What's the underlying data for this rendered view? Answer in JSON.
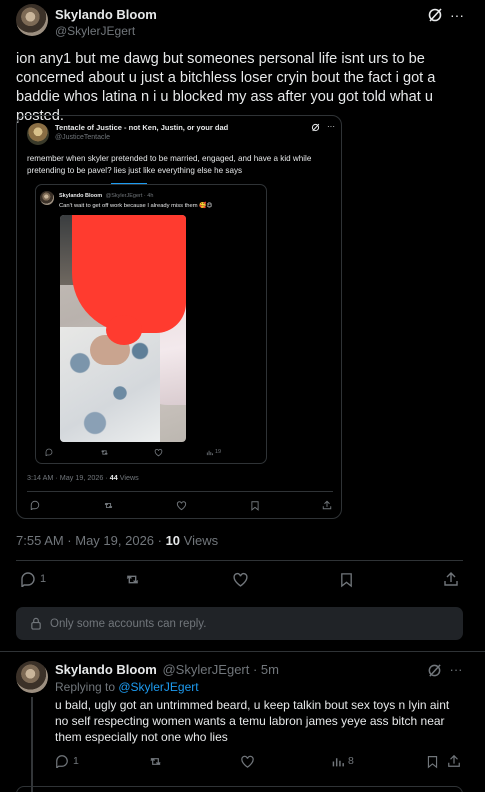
{
  "main_post": {
    "name": "Skylando Bloom",
    "handle": "@SkylerJEgert",
    "text": "ion any1 but me dawg but someones personal life isnt urs to be concerned about u just a bitchless loser cryin bout the fact i got a baddie whos latina n i u blocked my ass after you got told what u posted.",
    "timestamp": "7:55 AM · May 19, 2026 · ",
    "views_count": "10",
    "views_label": " Views",
    "reply_count": "1",
    "icons": [
      "reply-icon",
      "repost-icon",
      "like-icon",
      "bookmark-icon",
      "share-icon",
      "grok-icon",
      "more-icon"
    ]
  },
  "quoted_post": {
    "name": "Tentacle of Justice - not Ken, Justin, or your dad",
    "handle": "@JusticeTentacle",
    "text": "remember when skyler pretended to be married, engaged, and have a kid while pretending to be pavel? lies just like everything else he says",
    "timestamp": "3:14 AM · May 19, 2026 · ",
    "views_count": "44",
    "views_label": " Views"
  },
  "nested_post": {
    "name": "Skylando Bloom",
    "handle": "@SkylerJEgert · 4h",
    "text": "Can't wait to get off work because I already miss them 🥰😍",
    "views": "19"
  },
  "reply_restriction": "Only some accounts can reply.",
  "reply_post": {
    "name": "Skylando Bloom",
    "handle": "@SkylerJEgert · 5m",
    "replying_label": "Replying to ",
    "replying_to": "@SkylerJEgert",
    "text": "u bald, ugly got an untrimmed beard, u keep talkin bout sex toys n lyin aint no self respecting women wants a temu labron james yeye ass bitch near them especially not one who lies",
    "reply_count": "1",
    "views": "8"
  }
}
